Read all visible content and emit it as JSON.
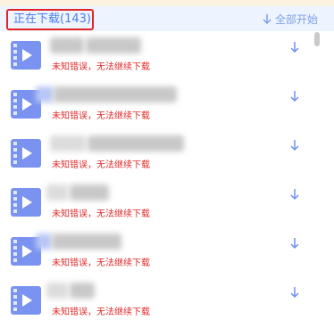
{
  "header": {
    "title": "正在下载(143)",
    "start_all_label": "全部开始"
  },
  "downloads": {
    "items": [
      {
        "status": "未知错误，无法继续下载"
      },
      {
        "status": "未知错误，无法继续下载"
      },
      {
        "status": "未知错误，无法继续下载"
      },
      {
        "status": "未知错误，无法继续下载"
      },
      {
        "status": "未知错误，无法继续下载"
      },
      {
        "status": "未知错误，无法继续下载"
      }
    ]
  },
  "colors": {
    "accent": "#4a7cf0",
    "error": "#e02a2a",
    "highlight_border": "#e02424",
    "header_bg": "#eef4ff",
    "icon": "#7b93f0"
  },
  "icons": {
    "file": "video-file-icon",
    "download": "download-arrow-icon"
  }
}
